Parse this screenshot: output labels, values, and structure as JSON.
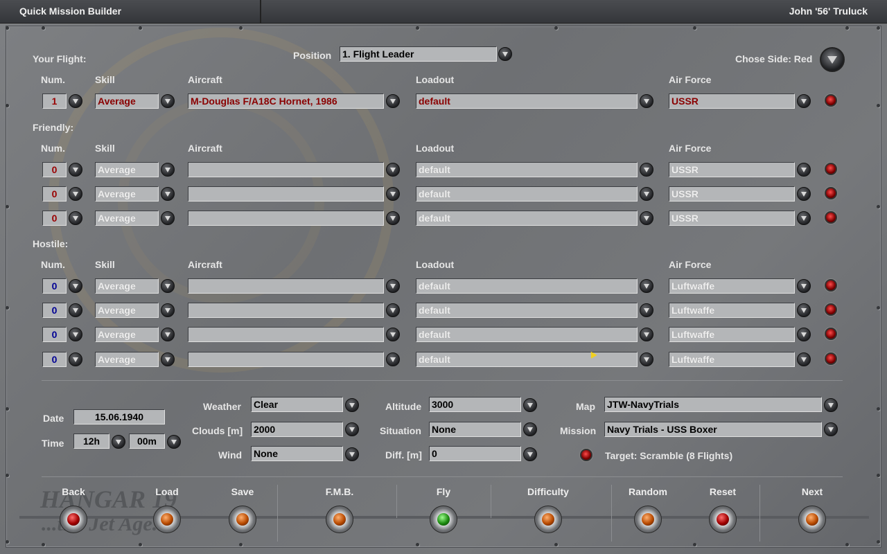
{
  "window": {
    "title": "Quick Mission Builder",
    "user": "John '56' Truluck"
  },
  "your_flight": {
    "section_label": "Your Flight:",
    "position_label": "Position",
    "position_value": "1. Flight Leader",
    "side_label": "Chose Side: Red",
    "row": {
      "num": "1",
      "skill": "Average",
      "aircraft": "M-Douglas F/A18C Hornet, 1986",
      "loadout": "default",
      "air_force": "USSR"
    }
  },
  "headers": {
    "num": "Num.",
    "skill": "Skill",
    "aircraft": "Aircraft",
    "loadout": "Loadout",
    "air_force": "Air Force"
  },
  "friendly": {
    "section_label": "Friendly:",
    "rows": [
      {
        "num": "0",
        "skill": "Average",
        "aircraft": "",
        "loadout": "default",
        "air_force": "USSR"
      },
      {
        "num": "0",
        "skill": "Average",
        "aircraft": "",
        "loadout": "default",
        "air_force": "USSR"
      },
      {
        "num": "0",
        "skill": "Average",
        "aircraft": "",
        "loadout": "default",
        "air_force": "USSR"
      }
    ]
  },
  "hostile": {
    "section_label": "Hostile:",
    "rows": [
      {
        "num": "0",
        "skill": "Average",
        "aircraft": "",
        "loadout": "default",
        "air_force": "Luftwaffe"
      },
      {
        "num": "0",
        "skill": "Average",
        "aircraft": "",
        "loadout": "default",
        "air_force": "Luftwaffe"
      },
      {
        "num": "0",
        "skill": "Average",
        "aircraft": "",
        "loadout": "default",
        "air_force": "Luftwaffe"
      },
      {
        "num": "0",
        "skill": "Average",
        "aircraft": "",
        "loadout": "default",
        "air_force": "Luftwaffe"
      }
    ]
  },
  "conditions": {
    "date_label": "Date",
    "date_value": "15.06.1940",
    "time_label": "Time",
    "time_hour": "12h",
    "time_min": "00m",
    "weather_label": "Weather",
    "weather_value": "Clear",
    "clouds_label": "Clouds [m]",
    "clouds_value": "2000",
    "wind_label": "Wind",
    "wind_value": "None",
    "altitude_label": "Altitude",
    "altitude_value": "3000",
    "situation_label": "Situation",
    "situation_value": "None",
    "diff_label": "Diff. [m]",
    "diff_value": "0",
    "map_label": "Map",
    "map_value": "JTW-NavyTrials",
    "mission_label": "Mission",
    "mission_value": "Navy Trials - USS Boxer",
    "target_text": "Target: Scramble (8 Flights)"
  },
  "buttons": {
    "back": "Back",
    "load": "Load",
    "save": "Save",
    "fmb": "F.M.B.",
    "fly": "Fly",
    "difficulty": "Difficulty",
    "random": "Random",
    "reset": "Reset",
    "next": "Next"
  },
  "watermark": {
    "logo": "HANGAR 19",
    "tagline": "...the Jet Age..."
  },
  "colors": {
    "active_text": "#8a0000",
    "friendly_num": "#9a0000",
    "hostile_num": "#000094",
    "led": "#d01010",
    "fly_lamp": "#1c8a10"
  }
}
